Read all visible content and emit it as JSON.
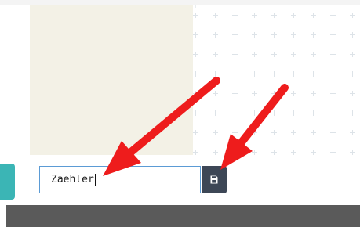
{
  "editor": {
    "name_input": {
      "value": "Zaehler"
    },
    "save_button": {
      "icon": "floppy-disk-icon"
    }
  },
  "colors": {
    "note_background": "#f3f1e6",
    "teal_accent": "#3bb5b5",
    "input_border": "#5b9bd5",
    "button_background": "#3d4756",
    "annotation_arrow": "#ee1c1c",
    "bottom_bar": "#5a5a5a"
  }
}
